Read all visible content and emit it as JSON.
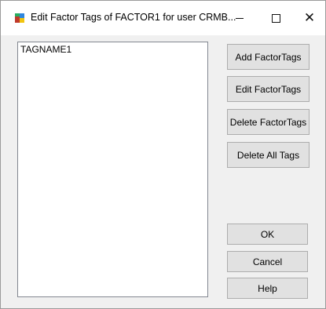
{
  "window": {
    "title": "Edit Factor Tags of FACTOR1 for user CRMB..."
  },
  "title_controls": {
    "minimize_icon": "minimize-icon",
    "maximize_icon": "maximize-icon",
    "close_glyph": "✕"
  },
  "tag_list": {
    "items": [
      "TAGNAME1"
    ]
  },
  "buttons": {
    "add": "Add FactorTags",
    "edit": "Edit FactorTags",
    "delete": "Delete FactorTags",
    "delete_all": "Delete All Tags",
    "ok": "OK",
    "cancel": "Cancel",
    "help": "Help"
  }
}
